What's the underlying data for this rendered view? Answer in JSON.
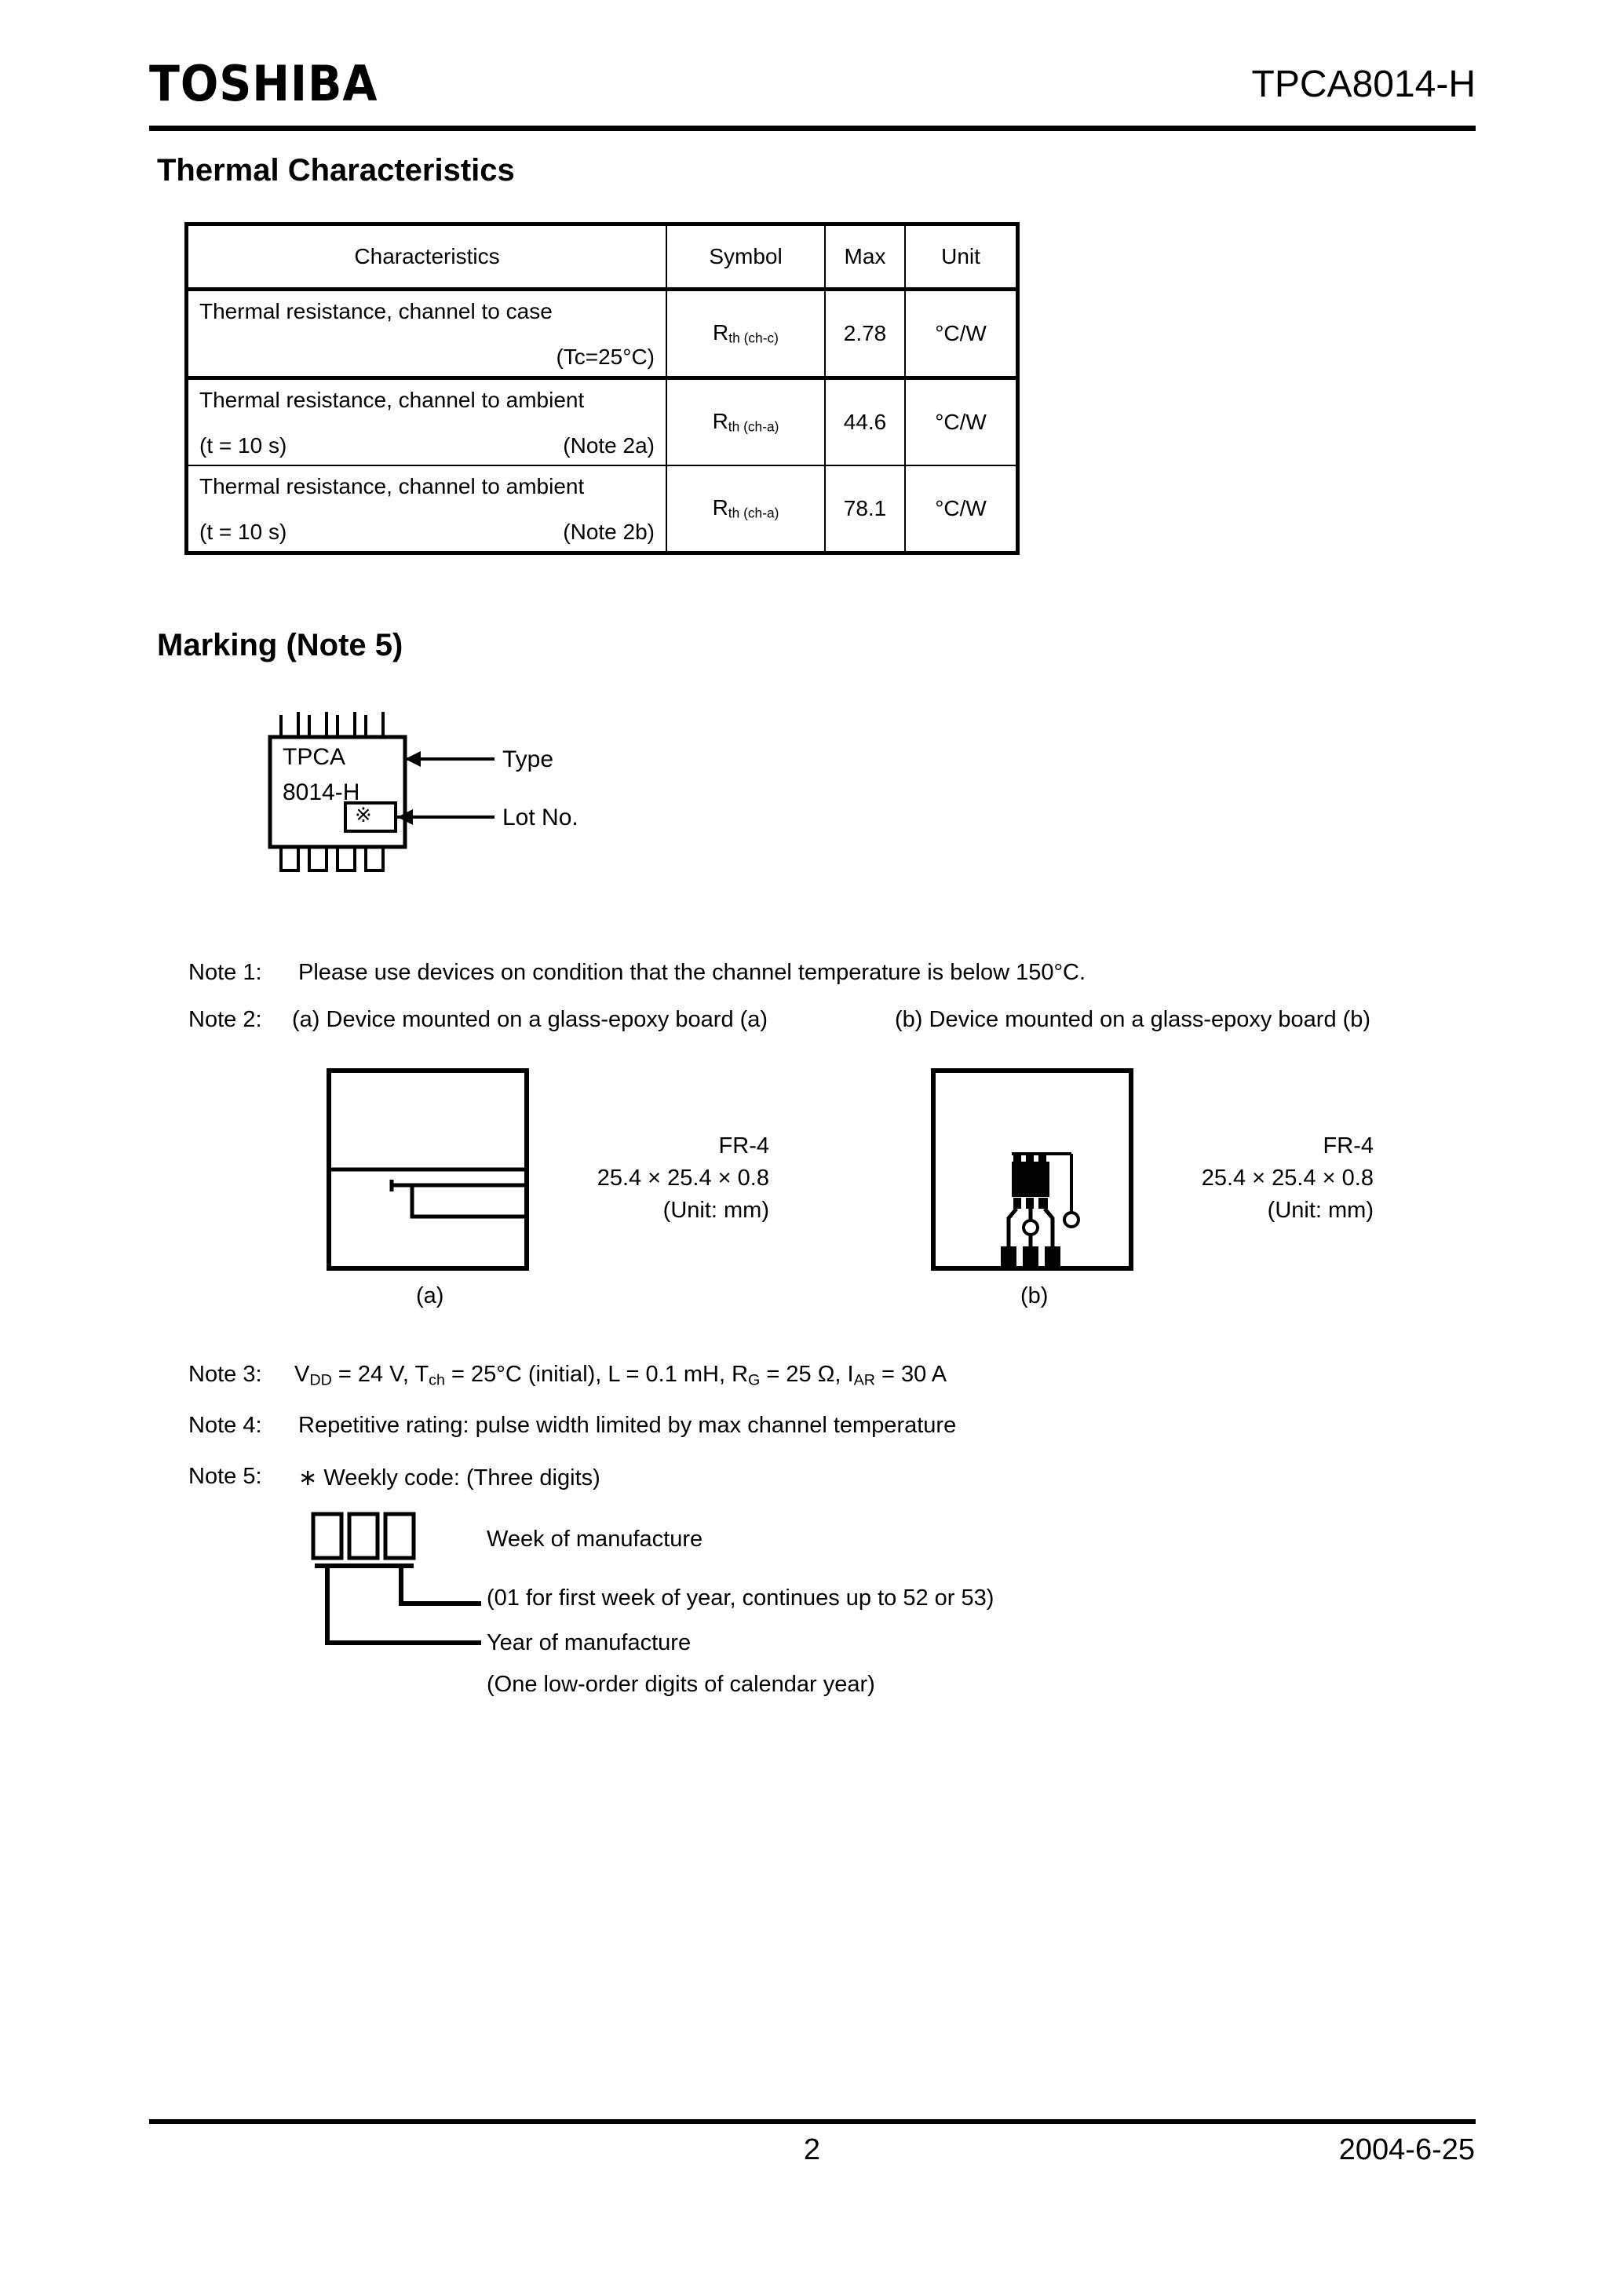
{
  "header": {
    "logo": "TOSHIBA",
    "part_number": "TPCA8014-H"
  },
  "sections": {
    "thermal_title": "Thermal Characteristics",
    "marking_title": "Marking (Note 5)"
  },
  "thermal_table": {
    "columns": [
      "Characteristics",
      "Symbol",
      "Max",
      "Unit"
    ],
    "rows": [
      {
        "characteristic_line1": "Thermal resistance, channel to case",
        "characteristic_line2_right": "(Tc=25°C)",
        "characteristic_line2_left": "",
        "symbol_main": "R",
        "symbol_sub": "th (ch-c)",
        "max": "2.78",
        "unit": "°C/W"
      },
      {
        "characteristic_line1": "Thermal resistance, channel to ambient",
        "characteristic_line2_left": "(t = 10 s)",
        "characteristic_line2_right": "(Note 2a)",
        "symbol_main": "R",
        "symbol_sub": "th (ch-a)",
        "max": "44.6",
        "unit": "°C/W"
      },
      {
        "characteristic_line1": "Thermal resistance, channel to ambient",
        "characteristic_line2_left": "(t = 10 s)",
        "characteristic_line2_right": "(Note 2b)",
        "symbol_main": "R",
        "symbol_sub": "th (ch-a)",
        "max": "78.1",
        "unit": "°C/W"
      }
    ]
  },
  "marking": {
    "package_text_line1": "TPCA",
    "package_text_line2": "8014-H",
    "lot_symbol": "※",
    "callout_type": "Type",
    "callout_lot": "Lot No."
  },
  "notes": {
    "note1_label": "Note 1:",
    "note1_text": "Please use devices on condition that the channel temperature is below 150°C.",
    "note2_label": "Note 2:",
    "note2_a": "(a) Device mounted on a glass-epoxy board (a)",
    "note2_b": "(b) Device mounted on a glass-epoxy board (b)",
    "note3_label": "Note 3:",
    "note3_text_parts": {
      "v1": "V",
      "v1sub": "DD",
      "v1val": " = 24 V, ",
      "t1": "T",
      "t1sub": "ch",
      "t1val": " = 25°C (initial), L = 0.1 mH, ",
      "r1": "R",
      "r1sub": "G",
      "r1val": " = 25 Ω, ",
      "i1": "I",
      "i1sub": "AR",
      "i1val": " = 30 A"
    },
    "note4_label": "Note 4:",
    "note4_text": "Repetitive rating: pulse width limited by max channel temperature",
    "note5_label": "Note 5:",
    "note5_text": "∗ Weekly code: (Three digits)"
  },
  "board_a": {
    "material": "FR-4",
    "dimensions": "25.4 × 25.4 × 0.8",
    "unit_note": "(Unit: mm)",
    "caption": "(a)"
  },
  "board_b": {
    "material": "FR-4",
    "dimensions": "25.4 × 25.4 × 0.8",
    "unit_note": "(Unit: mm)",
    "caption": "(b)"
  },
  "week_code": {
    "week_line1": "Week of manufacture",
    "week_line2": "(01 for first week of year, continues up to 52 or 53)",
    "year_line1": "Year of manufacture",
    "year_line2": "(One low-order digits of calendar year)"
  },
  "footer": {
    "page_number": "2",
    "date": "2004-6-25"
  }
}
